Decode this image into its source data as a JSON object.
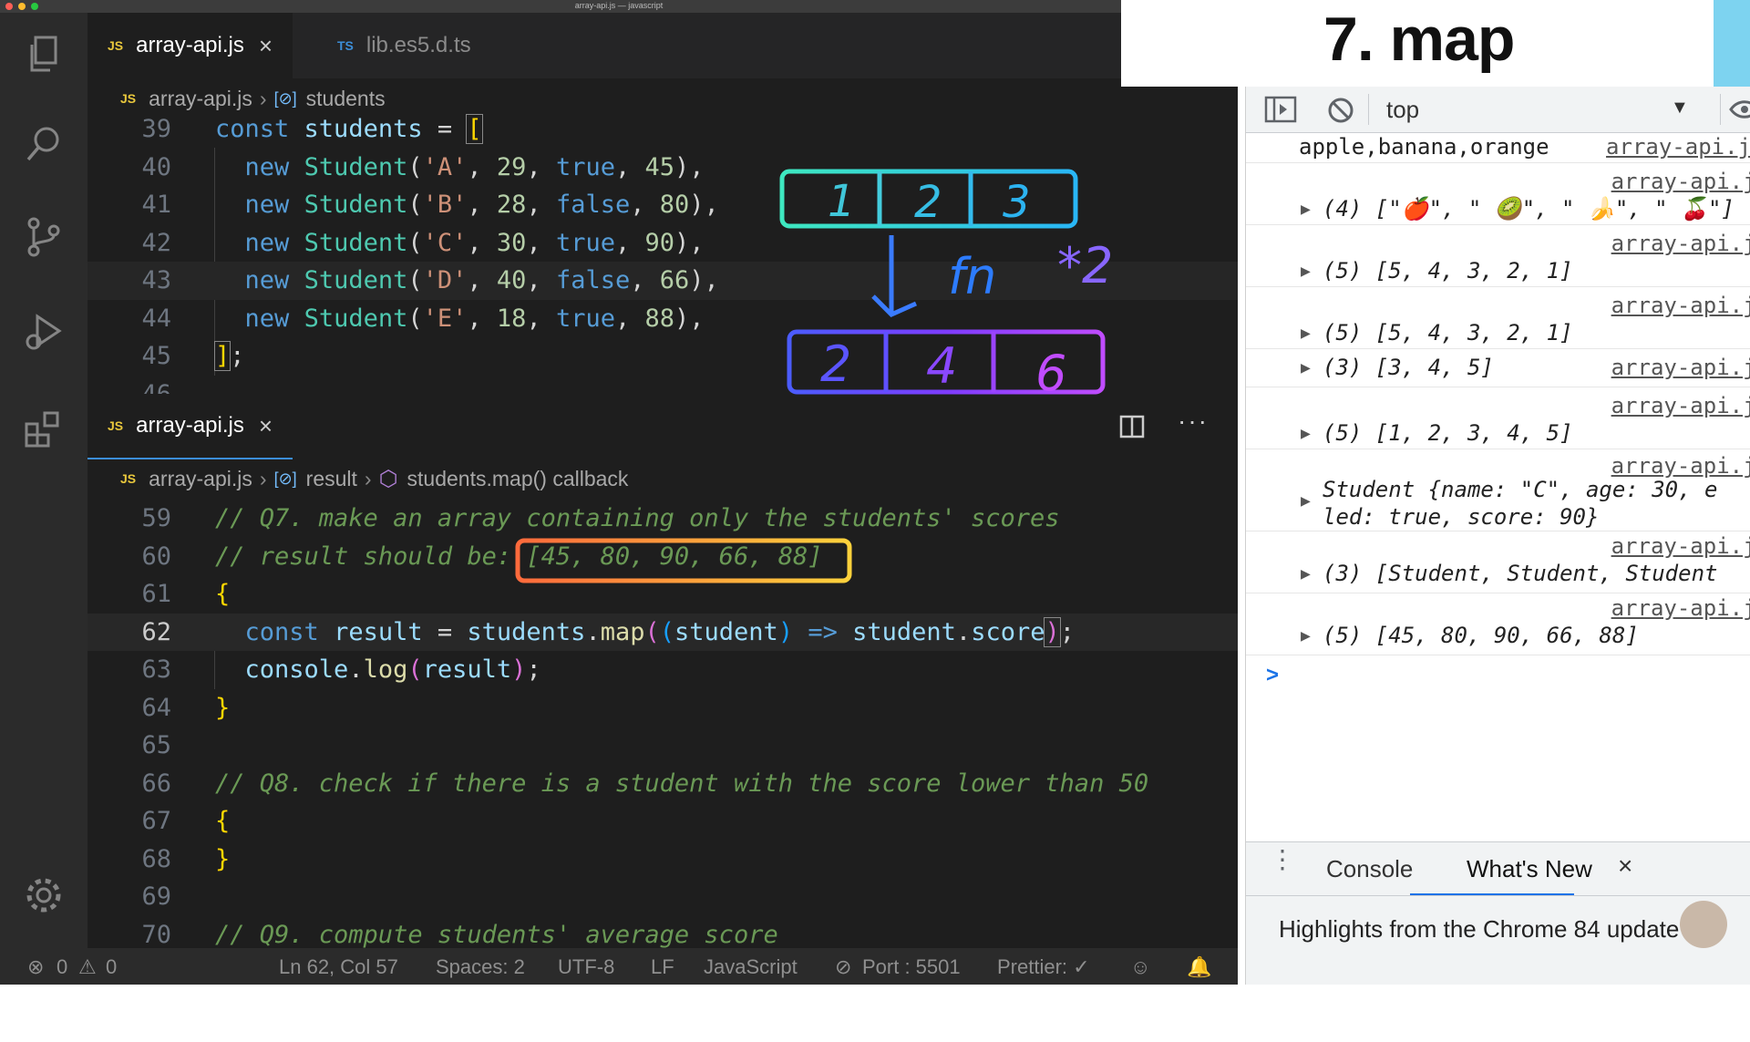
{
  "window": {
    "title": "array-api.js — javascript"
  },
  "tabs_top": [
    {
      "icon": "JS",
      "label": "array-api.js"
    },
    {
      "icon": "TS",
      "label": "lib.es5.d.ts"
    }
  ],
  "breadcrumb_top": {
    "file": "array-api.js",
    "symbol": "students"
  },
  "code_top": {
    "lines": [
      {
        "num": "39",
        "text": "const students = ["
      },
      {
        "num": "40",
        "text": "new Student('A', 29, true, 45),"
      },
      {
        "num": "41",
        "text": "new Student('B', 28, false, 80),"
      },
      {
        "num": "42",
        "text": "new Student('C', 30, true, 90),"
      },
      {
        "num": "43",
        "text": "new Student('D', 40, false, 66),"
      },
      {
        "num": "44",
        "text": "new Student('E', 18, true, 88),"
      },
      {
        "num": "45",
        "text": "];"
      },
      {
        "num": "46",
        "text": ""
      }
    ]
  },
  "tab_bottom": {
    "icon": "JS",
    "label": "array-api.js"
  },
  "breadcrumb_bottom": {
    "file": "array-api.js",
    "symbol1": "result",
    "symbol2": "students.map() callback"
  },
  "code_bottom": {
    "lines": [
      {
        "num": "59",
        "text": "// Q7. make an array containing only the students' scores"
      },
      {
        "num": "60",
        "text": "// result should be: [45, 80, 90, 66, 88]"
      },
      {
        "num": "61",
        "text": "{"
      },
      {
        "num": "62",
        "text": "const result = students.map((student) => student.score);"
      },
      {
        "num": "63",
        "text": "console.log(result);"
      },
      {
        "num": "64",
        "text": "}"
      },
      {
        "num": "65",
        "text": ""
      },
      {
        "num": "66",
        "text": "// Q8. check if there is a student with the score lower than 50"
      },
      {
        "num": "67",
        "text": "{"
      },
      {
        "num": "68",
        "text": "}"
      },
      {
        "num": "69",
        "text": ""
      },
      {
        "num": "70",
        "text": "// Q9. compute students' average score"
      }
    ]
  },
  "statusbar": {
    "errors": "0",
    "warnings": "0",
    "position": "Ln 62, Col 57",
    "spaces": "Spaces: 2",
    "encoding": "UTF-8",
    "eol": "LF",
    "language": "JavaScript",
    "port": "Port : 5501",
    "prettier": "Prettier: ✓"
  },
  "drawing": {
    "top_boxes": [
      "1",
      "2",
      "3"
    ],
    "fn_label": "fn",
    "mult_label": "*2",
    "bottom_boxes": [
      "2",
      "4",
      "6"
    ]
  },
  "title_card": {
    "text": "7. map"
  },
  "devtools": {
    "context": "top",
    "console": [
      {
        "value": "apple,banana,orange",
        "source": "array-api.j"
      },
      {
        "value": "(4) [\"🍎\", \" 🥝\", \" 🍌\", \" 🍒\"]",
        "source": "array-api.js"
      },
      {
        "value": "(5) [5, 4, 3, 2, 1]",
        "source": "array-api.js"
      },
      {
        "value": "(5) [5, 4, 3, 2, 1]",
        "source": "array-api.js"
      },
      {
        "value": "(3) [3, 4, 5]",
        "source": "array-api.js"
      },
      {
        "value": "(5) [1, 2, 3, 4, 5]",
        "source": "array-api.js"
      },
      {
        "value": "Student {name: \"C\", age: 30, e",
        "value2": "led: true, score: 90}",
        "source": "array-api.js"
      },
      {
        "value": "(3) [Student, Student, Student",
        "source": "array-api.js"
      },
      {
        "value": "(5) [45, 80, 90, 66, 88]",
        "source": "array-api.js"
      }
    ],
    "prompt": ">",
    "drawer_tabs": [
      "Console",
      "What's New"
    ],
    "drawer_text": "Highlights from the Chrome 84 update"
  }
}
